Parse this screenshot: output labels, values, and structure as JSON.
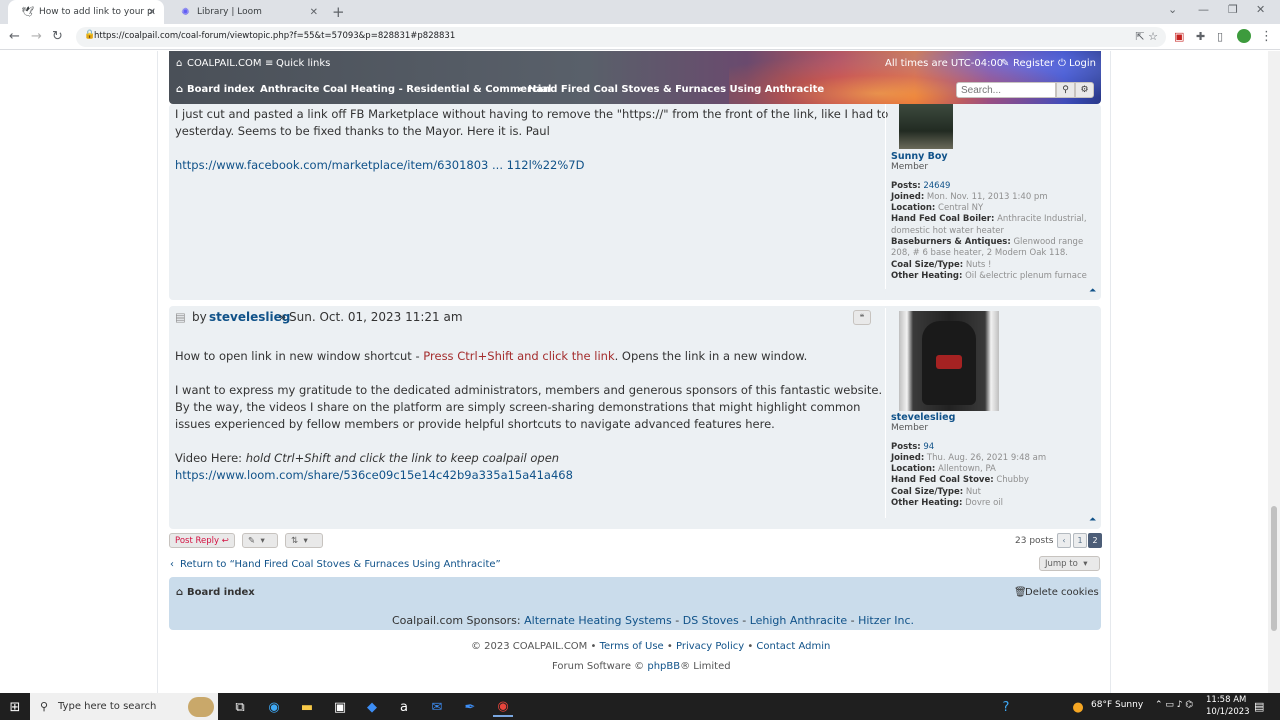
{
  "browser": {
    "tabs": [
      {
        "title": "How to add link to your post - ",
        "favicon": "forum-favicon"
      },
      {
        "title": "Library | Loom",
        "favicon": "loom-favicon"
      }
    ],
    "url": "https://coalpail.com/coal-forum/viewtopic.php?f=55&t=57093&p=828831#p828831"
  },
  "header": {
    "site_name": "COALPAIL.COM",
    "quick_links": "Quick links",
    "timezone": "All times are UTC-04:00",
    "register": "Register",
    "login": "Login",
    "crumbs": [
      "Board index",
      "Anthracite Coal Heating - Residential & Commercial",
      "Hand Fired Coal Stoves & Furnaces Using Anthracite"
    ],
    "search_placeholder": "Search..."
  },
  "post1": {
    "line1": "I just cut and pasted a link off FB Marketplace without having to remove the \"https://\" from the front of the link, like I had to",
    "line2": "yesterday. Seems to be fixed thanks to the Mayor. Here it is. Paul",
    "link": "https://www.facebook.com/marketplace/item/6301803 ... 112l%22%7D",
    "author": {
      "name": "Sunny Boy",
      "rank": "Member",
      "posts_label": "Posts:",
      "posts": "24649",
      "joined_label": "Joined:",
      "joined": "Mon. Nov. 11, 2013 1:40 pm",
      "location_label": "Location:",
      "location": "Central NY",
      "hf_label": "Hand Fed Coal Boiler:",
      "hf1": "Anthracite Industrial,",
      "hf2": "domestic hot water heater",
      "bb_label": "Baseburners & Antiques:",
      "bb1": "Glenwood range",
      "bb2": "208, # 6 base heater, 2 Modern Oak 118.",
      "size_label": "Coal Size/Type:",
      "size": "Nuts !",
      "other_label": "Other Heating:",
      "other": "Oil &electric plenum furnace"
    }
  },
  "post2": {
    "by": "by",
    "author_link": "steveleslieg",
    "sep": "»",
    "date": "Sun. Oct. 01, 2023 11:21 am",
    "p1_a": "How to open link in new window shortcut - ",
    "p1_b": "Press Ctrl+Shift and click the link",
    "p1_c": ". Opens the link in a new window.",
    "p2_l1": "I want to express my gratitude to the dedicated administrators, members and generous sponsors of this fantastic website.",
    "p2_l2": "By the way, the videos I share on the platform are simply screen-sharing demonstrations that might highlight common",
    "p2_l3": "issues experienced by fellow members or provide helpful shortcuts to navigate advanced features here.",
    "video_label": "Video Here: ",
    "video_note": "hold Ctrl+Shift and click the link to keep coalpail open",
    "loom_link": "https://www.loom.com/share/536ce09c15e14c42b9a335a15a41a468",
    "author": {
      "name": "steveleslieg",
      "rank": "Member",
      "posts_label": "Posts:",
      "posts": "94",
      "joined_label": "Joined:",
      "joined": "Thu. Aug. 26, 2021 9:48 am",
      "location_label": "Location:",
      "location": "Allentown, PA",
      "hf_label": "Hand Fed Coal Stove:",
      "hf": "Chubby",
      "size_label": "Coal Size/Type:",
      "size": "Nut",
      "other_label": "Other Heating:",
      "other": "Dovre oil"
    }
  },
  "actions": {
    "post_reply": "Post Reply",
    "posts_count": "23 posts",
    "pages": [
      "1",
      "2"
    ],
    "return_link": "Return to “Hand Fired Coal Stoves & Furnaces Using Anthracite”",
    "jump_to": "Jump to"
  },
  "footer": {
    "board_index": "Board index",
    "delete_cookies": "Delete cookies",
    "sponsors_label": "Coalpail.com Sponsors:",
    "sponsors": [
      "Alternate Heating Systems",
      "DS Stoves",
      "Lehigh Anthracite",
      "Hitzer Inc."
    ],
    "copyright": "© 2023 COALPAIL.COM",
    "terms": "Terms of Use",
    "privacy": "Privacy Policy",
    "contact": "Contact Admin",
    "software_prefix": "Forum Software ©",
    "phpbb": "phpBB",
    "software_suffix": "® Limited"
  },
  "taskbar": {
    "search_placeholder": "Type here to search",
    "weather": "68°F  Sunny",
    "time": "11:58 AM",
    "date": "10/1/2023"
  },
  "colors": {
    "link": "#105289",
    "highlight_red": "#a42d2d",
    "post_bg": "#ecf0f3",
    "navbar_bg": "#cadceb"
  }
}
